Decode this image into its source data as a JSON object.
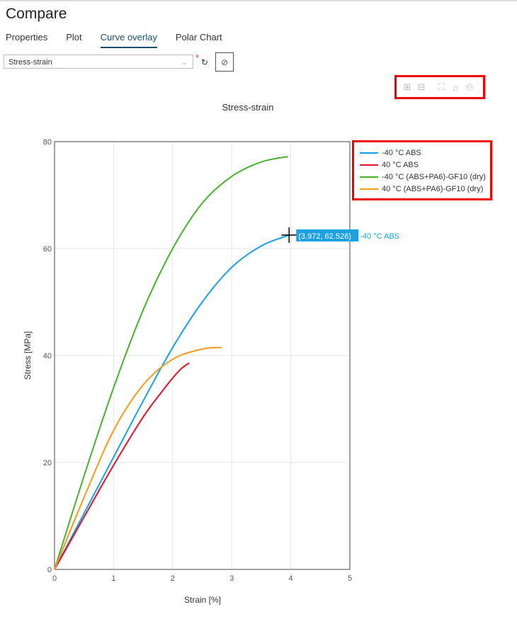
{
  "header": {
    "title": "Compare"
  },
  "tabs": [
    {
      "label": "Properties"
    },
    {
      "label": "Plot"
    },
    {
      "label": "Curve overlay",
      "active": true
    },
    {
      "label": "Polar Chart"
    }
  ],
  "selector": {
    "value": "Stress-strain",
    "required_mark": "*"
  },
  "toolbar_icons": [
    "zoom-in-icon",
    "zoom-out-icon",
    "autoscale-icon",
    "home-icon",
    "download-icon"
  ],
  "hover": {
    "label": "(3.972, 62.526)",
    "series": "-40 °C ABS"
  },
  "chart_data": {
    "type": "line",
    "title": "Stress-strain",
    "xlabel": "Strain [%]",
    "ylabel": "Stress [MPa]",
    "xlim": [
      0,
      5
    ],
    "ylim": [
      0,
      80
    ],
    "xticks": [
      0,
      1,
      2,
      3,
      4,
      5
    ],
    "yticks": [
      0,
      20,
      40,
      60,
      80
    ],
    "grid": true,
    "legend_position": "top-right-outside",
    "series": [
      {
        "name": "-40 °C ABS",
        "color": "#1ba1e2",
        "x": [
          0,
          0.5,
          1,
          1.5,
          2,
          2.5,
          3,
          3.5,
          3.972
        ],
        "y": [
          0,
          10.5,
          21,
          31.5,
          41.5,
          50,
          56.5,
          60.5,
          62.526
        ]
      },
      {
        "name": "40 °C ABS",
        "color": "#e3122a",
        "x": [
          0,
          0.5,
          1,
          1.5,
          1.8,
          2,
          2.15,
          2.28
        ],
        "y": [
          0,
          9.8,
          19.5,
          28.5,
          33,
          35.8,
          37.6,
          38.6
        ]
      },
      {
        "name": "-40 °C (ABS+PA6)-GF10 (dry)",
        "color": "#4cae33",
        "x": [
          0,
          0.5,
          1,
          1.5,
          2,
          2.5,
          3,
          3.5,
          3.95
        ],
        "y": [
          0,
          17.5,
          34,
          48.5,
          60,
          68.5,
          73.5,
          76.2,
          77.2
        ]
      },
      {
        "name": "40 °C (ABS+PA6)-GF10 (dry)",
        "color": "#f39c1f",
        "x": [
          0,
          0.5,
          1,
          1.5,
          2,
          2.5,
          2.83
        ],
        "y": [
          0,
          13.5,
          26,
          34.5,
          39.3,
          41.2,
          41.5
        ]
      }
    ]
  }
}
